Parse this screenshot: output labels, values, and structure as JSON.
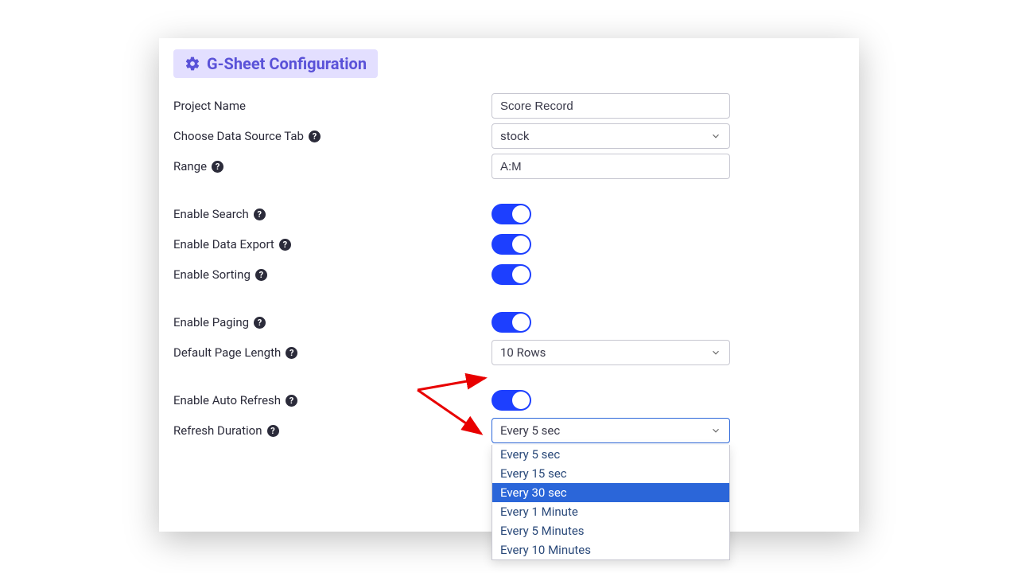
{
  "header": {
    "title": "G-Sheet Configuration"
  },
  "fields": {
    "project_name_label": "Project Name",
    "project_name_value": "Score Record",
    "data_source_label": "Choose Data Source Tab",
    "data_source_value": "stock",
    "range_label": "Range",
    "range_value": "A:M",
    "enable_search_label": "Enable Search",
    "enable_export_label": "Enable Data Export",
    "enable_sorting_label": "Enable Sorting",
    "enable_paging_label": "Enable Paging",
    "page_length_label": "Default Page Length",
    "page_length_value": "10 Rows",
    "auto_refresh_label": "Enable Auto Refresh",
    "refresh_duration_label": "Refresh Duration",
    "refresh_duration_value": "Every 5 sec"
  },
  "refresh_options": [
    "Every 5 sec",
    "Every 15 sec",
    "Every 30 sec",
    "Every 1 Minute",
    "Every 5 Minutes",
    "Every 10 Minutes"
  ],
  "refresh_highlighted_index": 2
}
